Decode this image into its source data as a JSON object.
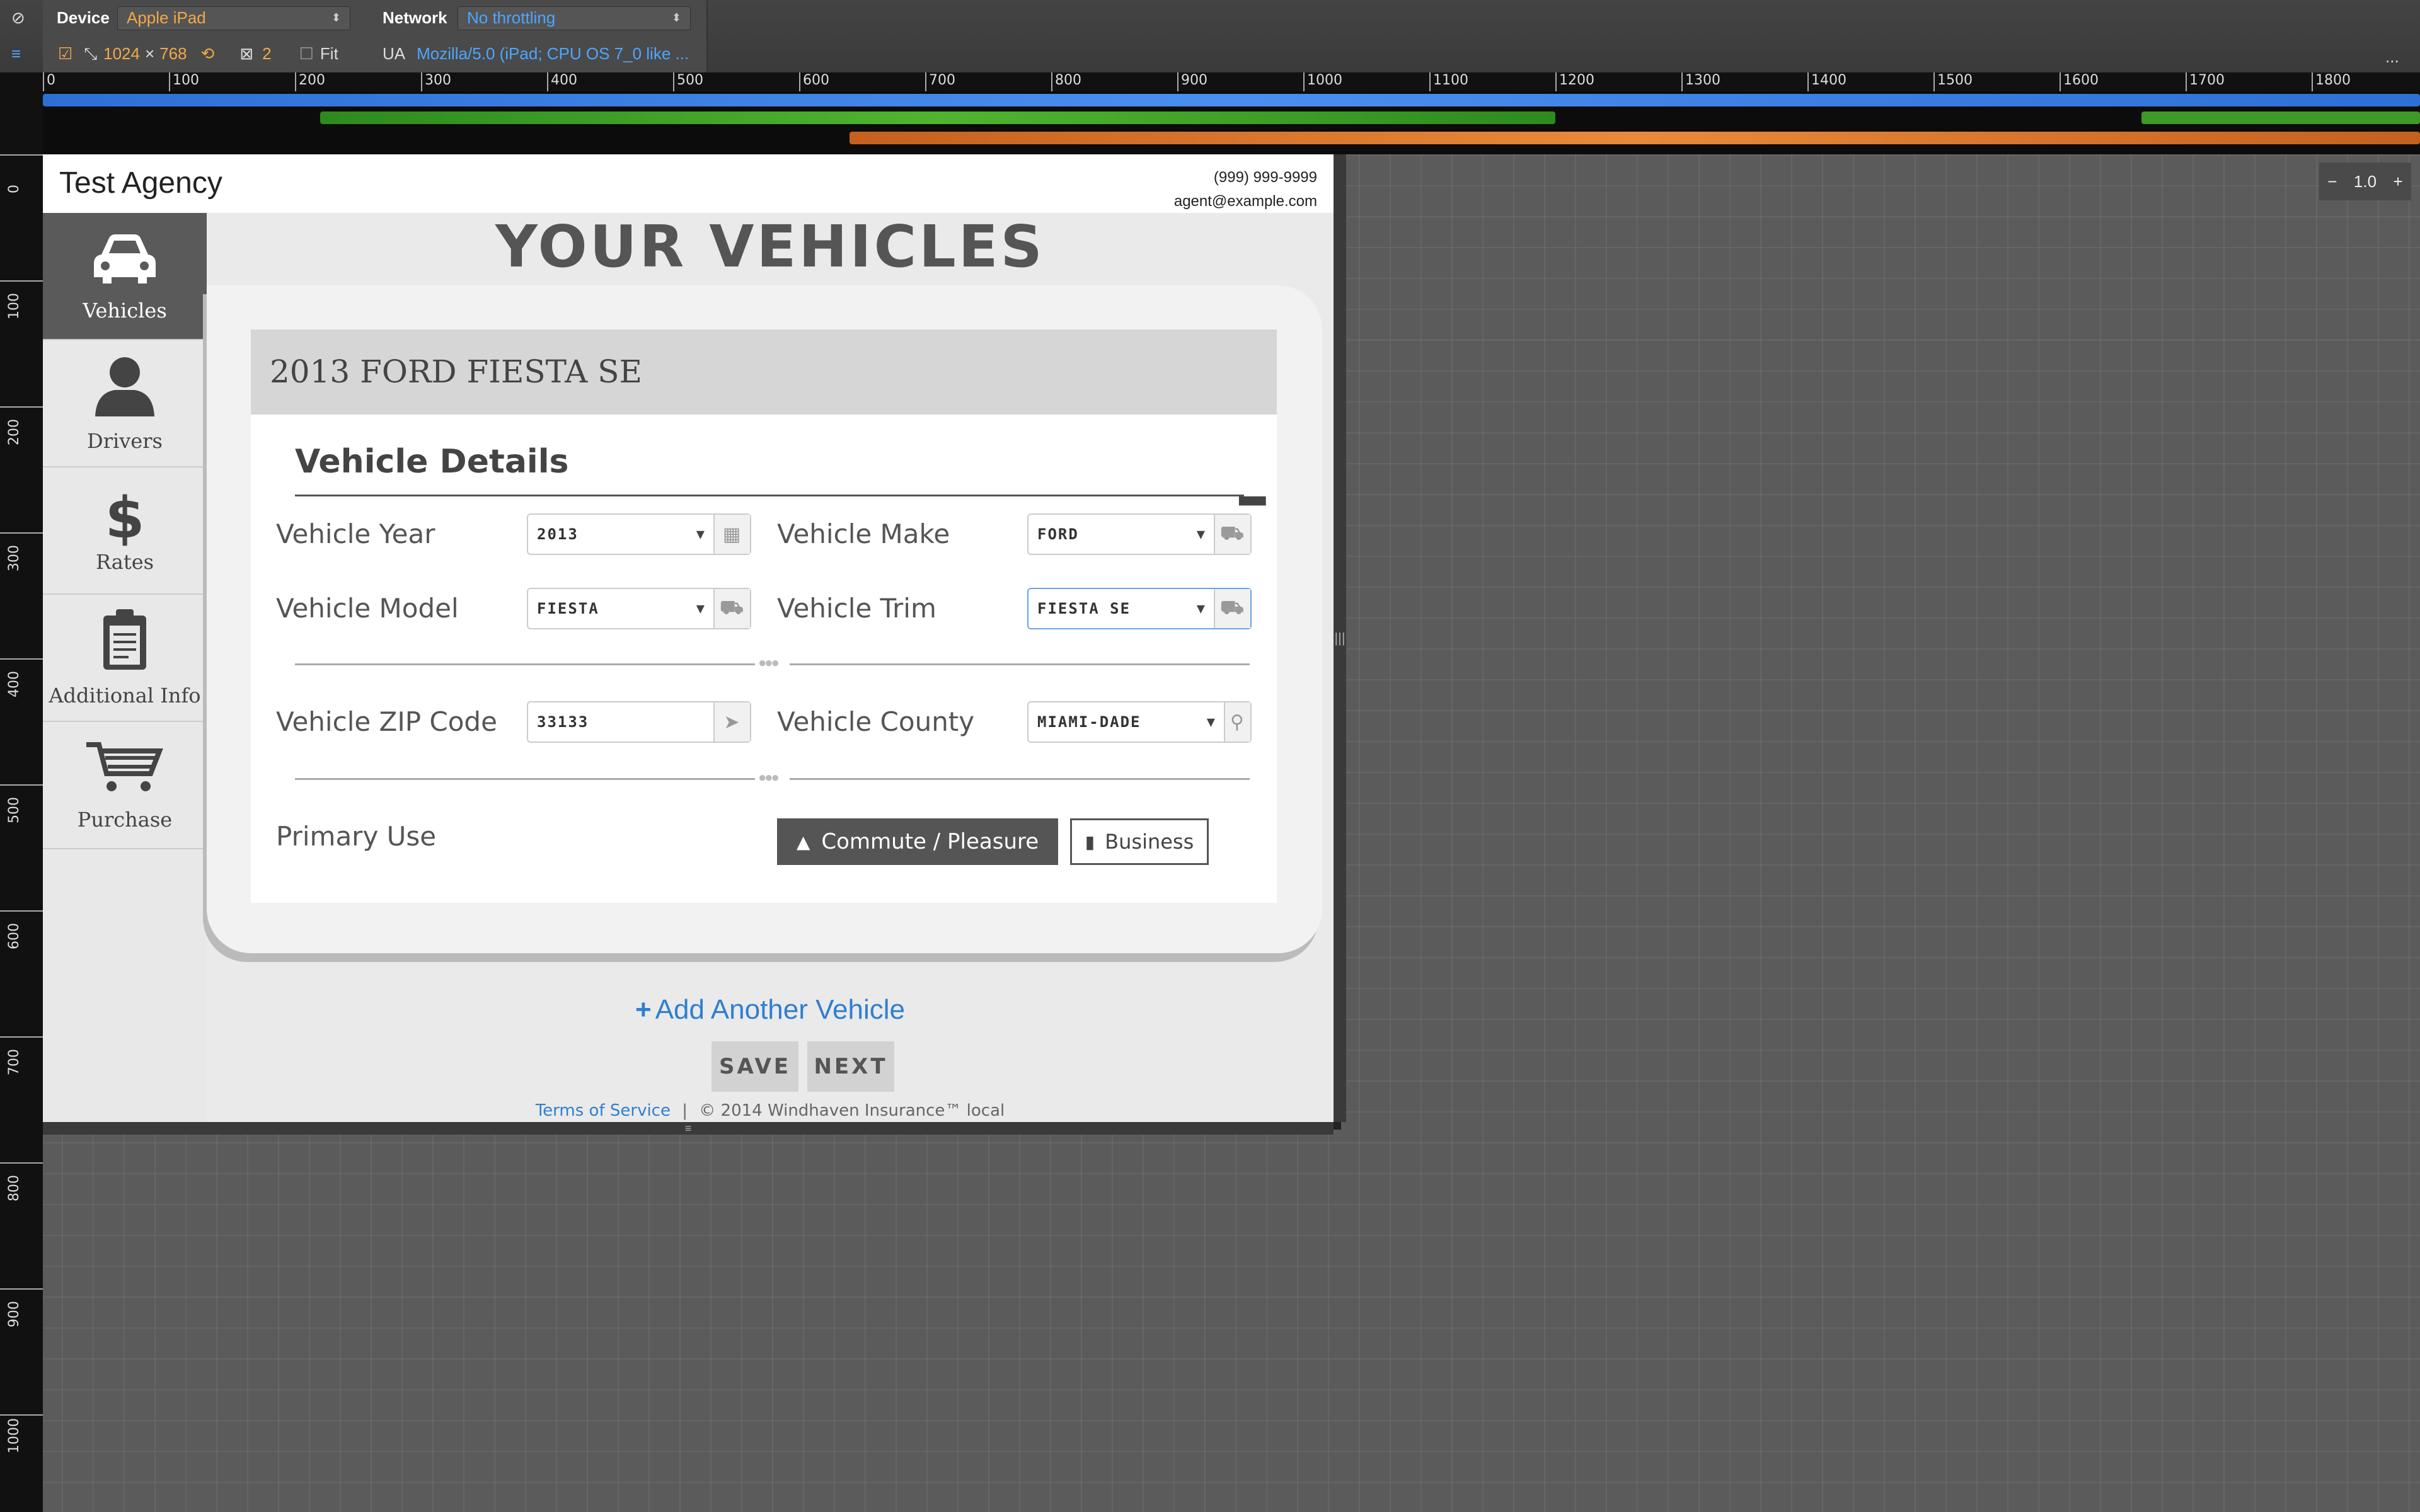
{
  "devtools": {
    "device_label": "Device",
    "device_value": "Apple iPad",
    "network_label": "Network",
    "network_value": "No throttling",
    "width": "1024",
    "times": "×",
    "height": "768",
    "dpr": "2",
    "fit_label": "Fit",
    "ua_label": "UA",
    "ua_value": "Mozilla/5.0 (iPad; CPU OS 7_0 like ...",
    "more": "...",
    "zoom_minus": "−",
    "zoom_value": "1.0",
    "zoom_plus": "+"
  },
  "ruler": {
    "top_ticks": [
      "0",
      "100",
      "200",
      "300",
      "400",
      "500",
      "600",
      "700",
      "800",
      "900",
      "1000",
      "1100",
      "1200",
      "1300",
      "1400",
      "1500",
      "1600",
      "1700",
      "1800"
    ],
    "left_ticks": [
      "0",
      "100",
      "200",
      "300",
      "400",
      "500",
      "600",
      "700",
      "800",
      "900",
      "1000"
    ]
  },
  "header": {
    "agency": "Test Agency",
    "phone": "(999) 999-9999",
    "email": "agent@example.com"
  },
  "sidebar": {
    "items": [
      {
        "label": "Vehicles",
        "icon": "car-icon"
      },
      {
        "label": "Drivers",
        "icon": "person-icon"
      },
      {
        "label": "Rates",
        "icon": "dollar-icon"
      },
      {
        "label": "Additional Info",
        "icon": "clipboard-icon"
      },
      {
        "label": "Purchase",
        "icon": "cart-icon"
      }
    ]
  },
  "main": {
    "title": "YOUR VEHICLES",
    "vehicle_heading": "2013 FORD FIESTA SE",
    "section": "Vehicle Details",
    "fields": {
      "year_label": "Vehicle Year",
      "year_value": "2013",
      "make_label": "Vehicle Make",
      "make_value": "FORD",
      "model_label": "Vehicle Model",
      "model_value": "FIESTA",
      "trim_label": "Vehicle Trim",
      "trim_value": "FIESTA SE",
      "zip_label": "Vehicle ZIP Code",
      "zip_value": "33133",
      "county_label": "Vehicle County",
      "county_value": "MIAMI-DADE",
      "use_label": "Primary Use"
    },
    "use_options": {
      "commute": "Commute / Pleasure",
      "business": "Business"
    },
    "add_vehicle": "Add Another Vehicle",
    "save": "SAVE",
    "next": "NEXT",
    "footer_tos": "Terms of Service",
    "footer_sep": "|",
    "footer_text": "© 2014 Windhaven Insurance™ local"
  }
}
